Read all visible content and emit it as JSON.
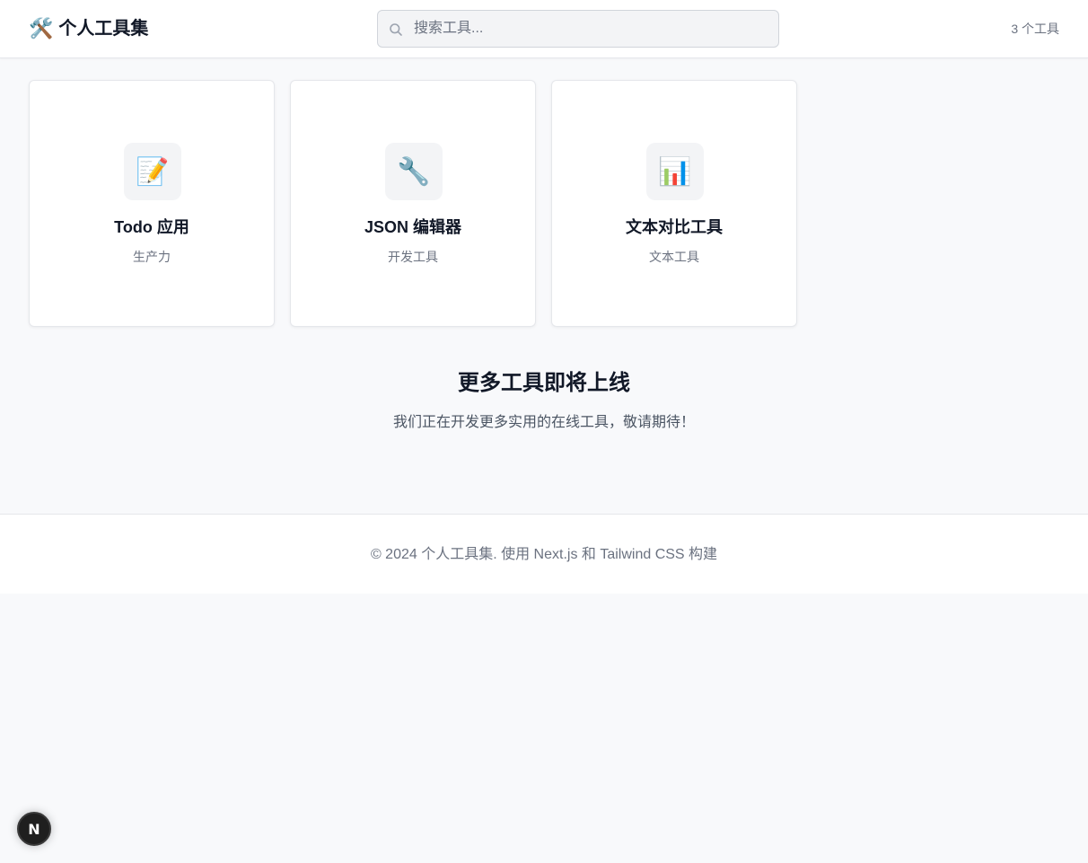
{
  "header": {
    "brand_icon": "🛠️",
    "title": "个人工具集",
    "search": {
      "placeholder": "搜索工具..."
    },
    "tool_count": "3 个工具"
  },
  "tools": [
    {
      "icon": "📝",
      "icon_name": "memo-icon",
      "title": "Todo 应用",
      "category": "生产力"
    },
    {
      "icon": "🔧",
      "icon_name": "wrench-icon",
      "title": "JSON 编辑器",
      "category": "开发工具"
    },
    {
      "icon": "📊",
      "icon_name": "bar-chart-icon",
      "title": "文本对比工具",
      "category": "文本工具"
    }
  ],
  "coming_soon": {
    "title": "更多工具即将上线",
    "description": "我们正在开发更多实用的在线工具，敬请期待！"
  },
  "footer": {
    "text": "© 2024 个人工具集. 使用 Next.js 和 Tailwind CSS 构建"
  },
  "dev_badge": {
    "label": "N"
  },
  "colors": {
    "background": "#f8f9fb",
    "text_primary": "#111827",
    "text_muted": "#6b7280"
  }
}
